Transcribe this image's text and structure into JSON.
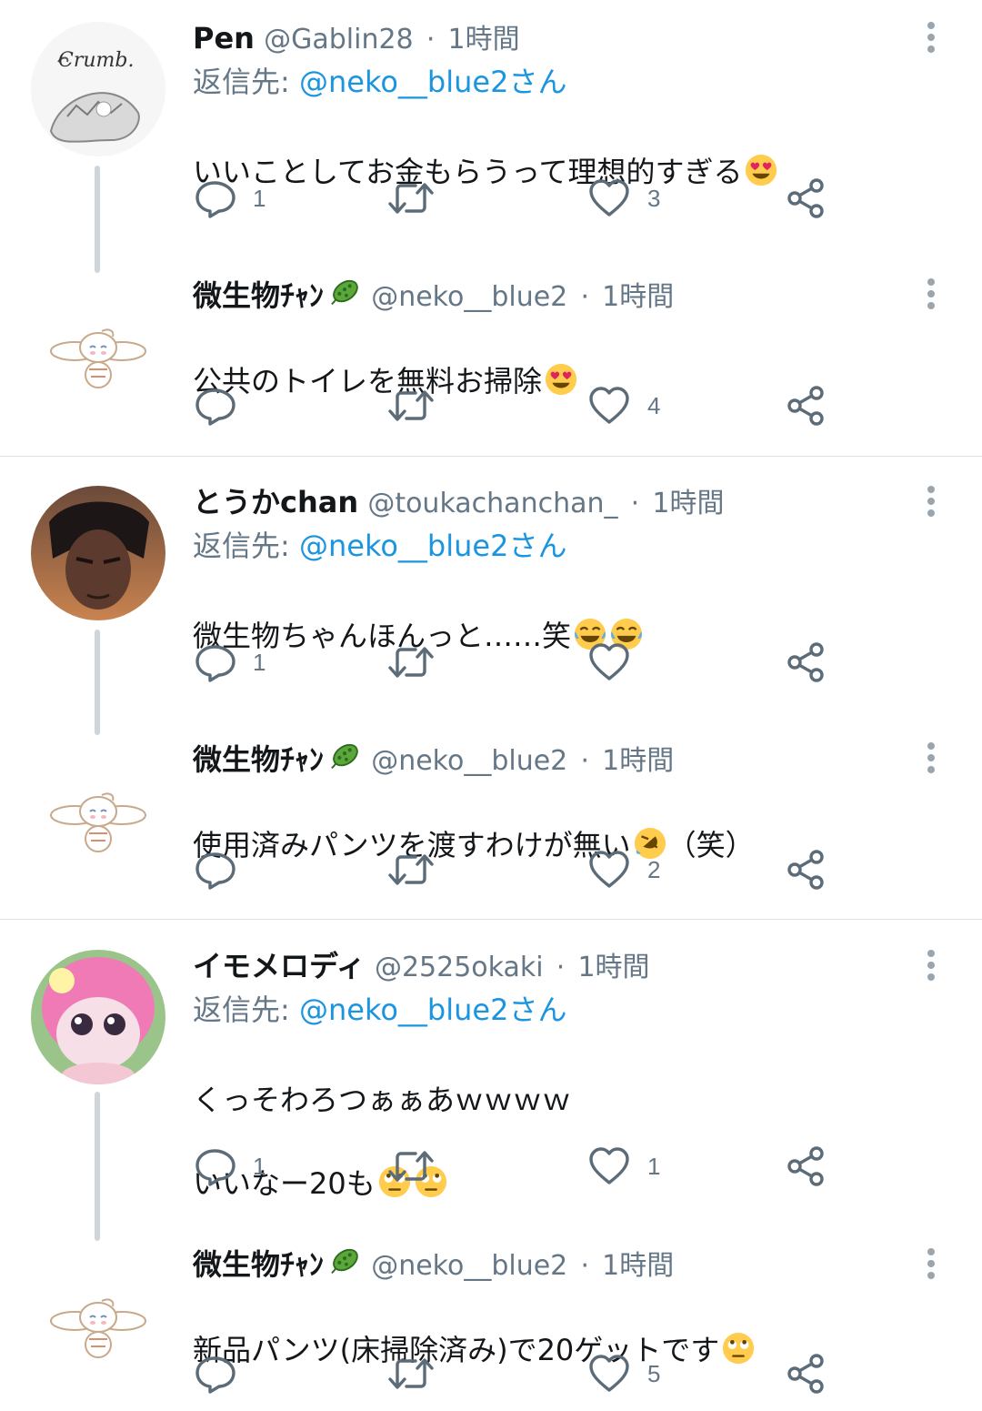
{
  "groups": [
    {
      "parent": {
        "name": "Pen",
        "handle": "@Gablin28",
        "time": "1時間",
        "reply_to_prefix": "返信先: ",
        "reply_to_handle": "@neko__blue2さん",
        "text": "いいことしてお金もらうって理想的すぎる",
        "text_emoji": "heart-eyes",
        "counts": {
          "reply": "1",
          "retweet": "",
          "like": "3"
        },
        "avatar_text": "Crumb."
      },
      "reply": {
        "name": "微生物ﾁｬﾝ",
        "handle": "@neko__blue2",
        "time": "1時間",
        "text": "公共のトイレを無料お掃除",
        "text_emoji": "heart-eyes",
        "counts": {
          "reply": "",
          "retweet": "",
          "like": "4"
        }
      }
    },
    {
      "parent": {
        "name": "とうかchan",
        "handle": "@toukachanchan_",
        "time": "1時間",
        "reply_to_prefix": "返信先: ",
        "reply_to_handle": "@neko__blue2さん",
        "text": "微生物ちゃんほんっと……笑",
        "text_emoji": "joy-joy",
        "counts": {
          "reply": "1",
          "retweet": "",
          "like": ""
        }
      },
      "reply": {
        "name": "微生物ﾁｬﾝ",
        "handle": "@neko__blue2",
        "time": "1時間",
        "text": "使用済みパンツを渡すわけが無い",
        "text_suffix": "（笑）",
        "text_emoji": "rofl",
        "counts": {
          "reply": "",
          "retweet": "",
          "like": "2"
        }
      }
    },
    {
      "parent": {
        "name": "イモメロディ",
        "handle": "@2525okaki",
        "time": "1時間",
        "reply_to_prefix": "返信先: ",
        "reply_to_handle": "@neko__blue2さん",
        "text_line1": "くっそわろつぁぁあｗｗｗｗ",
        "text_line2": "いいなー20も",
        "text_emoji": "eye-roll-eye-roll",
        "counts": {
          "reply": "1",
          "retweet": "",
          "like": "1"
        }
      },
      "reply": {
        "name": "微生物ﾁｬﾝ",
        "handle": "@neko__blue2",
        "time": "1時間",
        "text": "新品パンツ(床掃除済み)で20ゲットです",
        "text_emoji": "eye-roll",
        "counts": {
          "reply": "",
          "retweet": "",
          "like": "5"
        }
      }
    }
  ],
  "separator_char": "·",
  "colors": {
    "text": "#14171a",
    "muted": "#657786",
    "link": "#1b95e0",
    "divider": "#dfe3e6",
    "thread_line": "#cfd6db"
  },
  "icons": [
    "reply-icon",
    "retweet-icon",
    "like-icon",
    "share-icon",
    "more-options-icon",
    "microbe-icon"
  ]
}
